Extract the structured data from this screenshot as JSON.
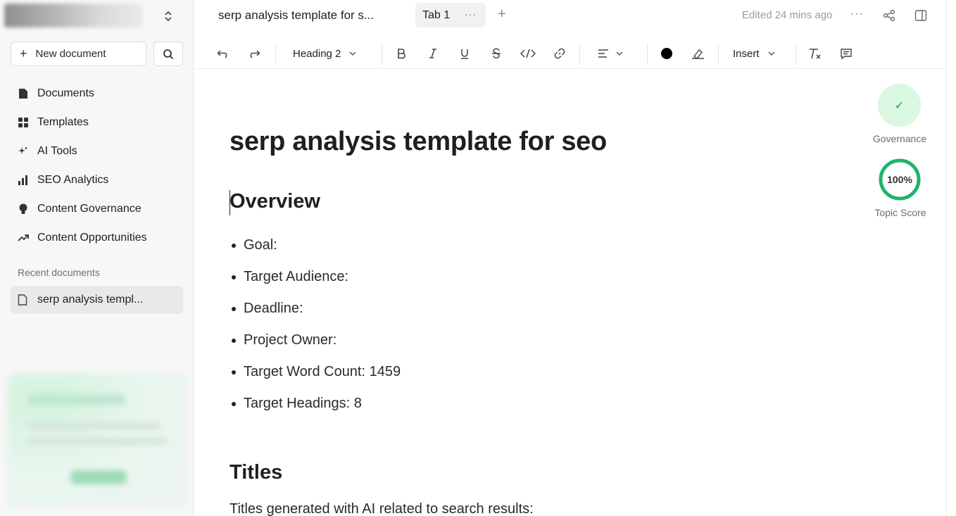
{
  "sidebar": {
    "new_document_label": "New document",
    "items": [
      {
        "label": "Documents",
        "icon": "document-icon"
      },
      {
        "label": "Templates",
        "icon": "grid-icon"
      },
      {
        "label": "AI Tools",
        "icon": "sparkle-icon"
      },
      {
        "label": "SEO Analytics",
        "icon": "bar-chart-icon"
      },
      {
        "label": "Content Governance",
        "icon": "lightbulb-icon"
      },
      {
        "label": "Content Opportunities",
        "icon": "trend-up-icon"
      }
    ],
    "recent_label": "Recent documents",
    "recent_items": [
      {
        "label": "serp analysis templ..."
      }
    ]
  },
  "header": {
    "doc_title": "serp analysis template for s...",
    "tab_label": "Tab 1",
    "tab_more": "···",
    "add_tab": "+",
    "edited": "Edited 24 mins ago",
    "more": "···"
  },
  "toolbar": {
    "heading_select": "Heading 2",
    "insert_label": "Insert"
  },
  "right_panel": {
    "governance_label": "Governance",
    "governance_check": "✓",
    "topic_score_value": 100,
    "topic_score_text": "100%",
    "topic_score_label": "Topic Score",
    "accent": "#1db56b"
  },
  "document": {
    "title": "serp analysis template for seo",
    "overview_heading": "Overview",
    "overview_items": [
      "Goal:",
      "Target Audience:",
      "Deadline:",
      "Project Owner:",
      "Target Word Count: 1459",
      "Target Headings: 8"
    ],
    "titles_heading": "Titles",
    "titles_paragraph": "Titles generated with AI related to search results:"
  }
}
